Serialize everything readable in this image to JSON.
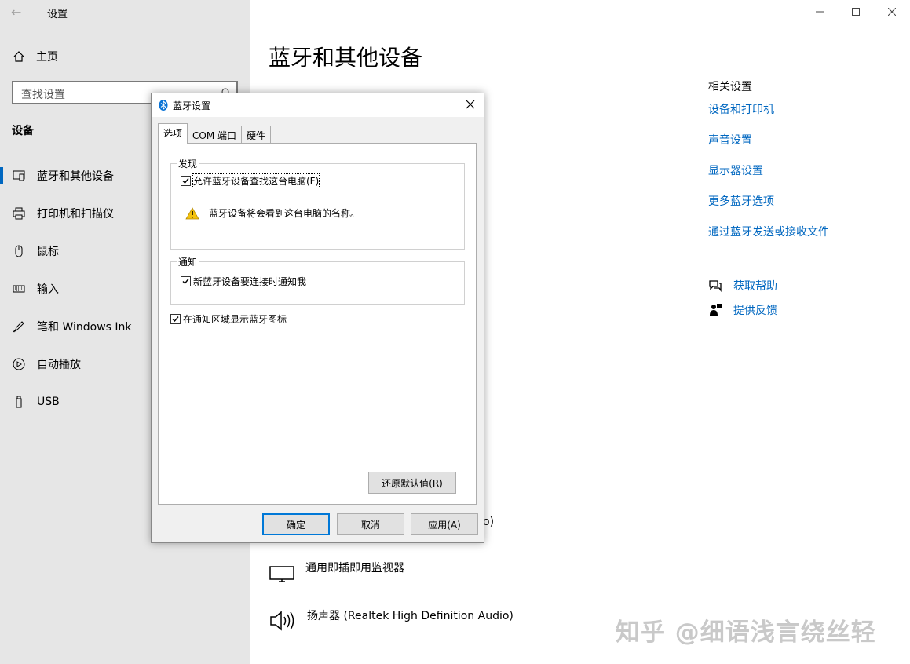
{
  "app": {
    "title": "设置",
    "home": "主页"
  },
  "search": {
    "placeholder": "查找设置"
  },
  "sidebar": {
    "section": "设备",
    "items": [
      {
        "label": "蓝牙和其他设备"
      },
      {
        "label": "打印机和扫描仪"
      },
      {
        "label": "鼠标"
      },
      {
        "label": "输入"
      },
      {
        "label": "笔和 Windows Ink"
      },
      {
        "label": "自动播放"
      },
      {
        "label": "USB"
      }
    ]
  },
  "main": {
    "title": "蓝牙和其他设备",
    "related_title": "相关设置",
    "related_links": [
      "设备和打印机",
      "声音设置",
      "显示器设置",
      "更多蓝牙选项",
      "通过蓝牙发送或接收文件"
    ],
    "help": [
      "获取帮助",
      "提供反馈"
    ],
    "partial": "o)",
    "devices": [
      {
        "label": "通用即插即用监视器",
        "icon": "monitor-icon"
      },
      {
        "label": "扬声器 (Realtek High Definition Audio)",
        "icon": "speaker-icon"
      }
    ]
  },
  "dialog": {
    "title": "蓝牙设置",
    "tabs": [
      "选项",
      "COM 端口",
      "硬件"
    ],
    "discovery_group": "发现",
    "allow_discovery": "允许蓝牙设备查找这台电脑(F)",
    "warning": "蓝牙设备将会看到这台电脑的名称。",
    "notify_group": "通知",
    "notify_new": "新蓝牙设备要连接时通知我",
    "show_icon": "在通知区域显示蓝牙图标",
    "restore": "还原默认值(R)",
    "ok": "确定",
    "cancel": "取消",
    "apply": "应用(A)"
  },
  "watermark": "知乎 @细语浅言绕丝轻",
  "colors": {
    "accent": "#0067c0",
    "sidebar_bg": "#e6e6e6",
    "dialog_bg": "#f0f0f0"
  }
}
